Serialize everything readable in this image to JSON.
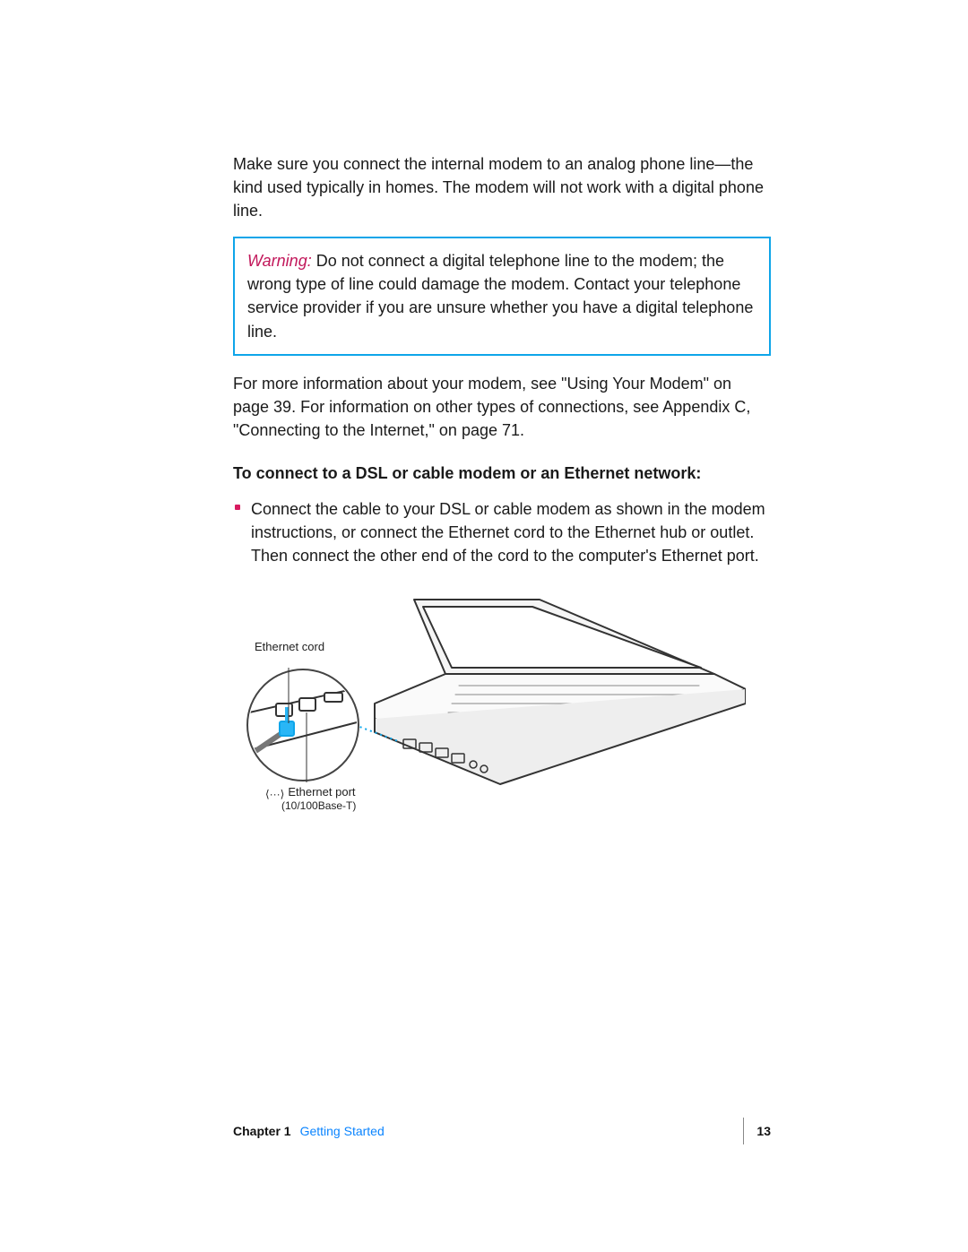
{
  "body": {
    "intro": "Make sure you connect the internal modem to an analog phone line—the kind used typically in homes. The modem will not work with a digital phone line.",
    "warning_label": "Warning:",
    "warning_text": "  Do not connect a digital telephone line to the modem; the wrong type of line could damage the modem. Contact your telephone service provider if you are unsure whether you have a digital telephone line.",
    "more_info": "For more information about your modem, see \"Using Your Modem\" on page 39. For information on other types of connections, see Appendix C, \"Connecting to the Internet,\" on page 71.",
    "heading": "To connect to a DSL or cable modem or an Ethernet network:",
    "bullet": "Connect the cable to your DSL or cable modem as shown in the modem instructions, or connect the Ethernet cord to the Ethernet hub or outlet. Then connect the other end of the cord to the computer's Ethernet port."
  },
  "figure": {
    "label_cord": "Ethernet cord",
    "label_port": "Ethernet port",
    "label_port_sub": "(10/100Base-T)",
    "icon_glyph": "⟨···⟩"
  },
  "footer": {
    "chapter": "Chapter 1",
    "title": "Getting Started",
    "page": "13"
  }
}
